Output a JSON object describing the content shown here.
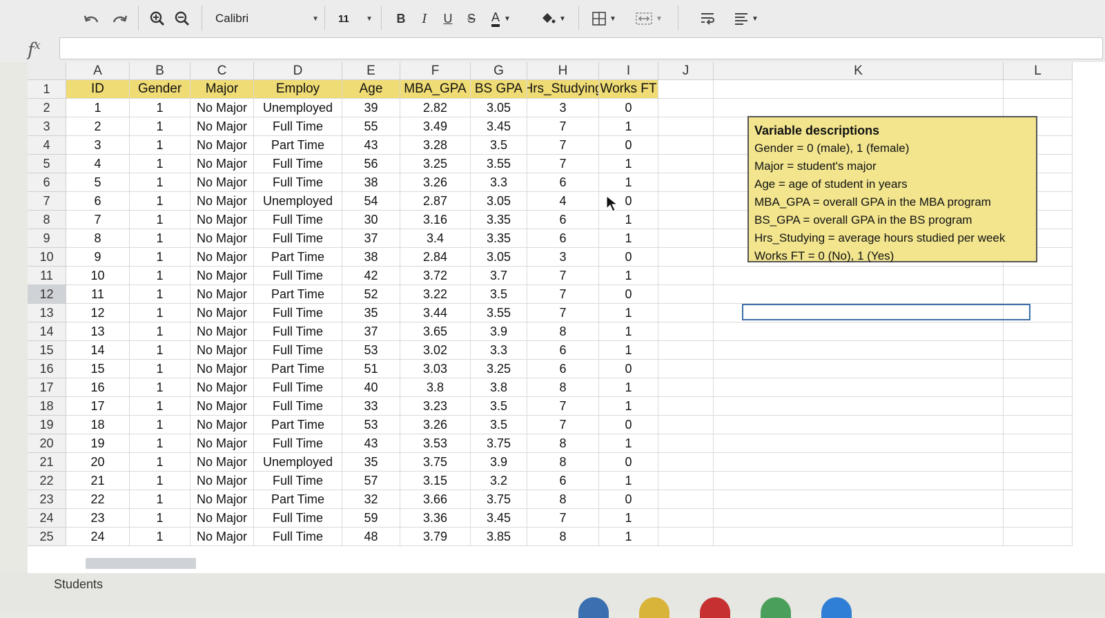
{
  "toolbar": {
    "font_name": "Calibri",
    "font_size": "11",
    "bold": "B",
    "italic": "I",
    "underline": "U",
    "strike": "S",
    "font_color": "A"
  },
  "formula_bar": {
    "label": "f",
    "sup": "x",
    "value": ""
  },
  "columns": [
    "A",
    "B",
    "C",
    "D",
    "E",
    "F",
    "G",
    "H",
    "I",
    "J",
    "K",
    "L"
  ],
  "headers": [
    "ID",
    "Gender",
    "Major",
    "Employ",
    "Age",
    "MBA_GPA",
    "BS GPA",
    "Hrs_Studying",
    "Works FT"
  ],
  "rows": [
    [
      "1",
      "1",
      "No Major",
      "Unemployed",
      "39",
      "2.82",
      "3.05",
      "3",
      "0"
    ],
    [
      "2",
      "1",
      "No Major",
      "Full Time",
      "55",
      "3.49",
      "3.45",
      "7",
      "1"
    ],
    [
      "3",
      "1",
      "No Major",
      "Part Time",
      "43",
      "3.28",
      "3.5",
      "7",
      "0"
    ],
    [
      "4",
      "1",
      "No Major",
      "Full Time",
      "56",
      "3.25",
      "3.55",
      "7",
      "1"
    ],
    [
      "5",
      "1",
      "No Major",
      "Full Time",
      "38",
      "3.26",
      "3.3",
      "6",
      "1"
    ],
    [
      "6",
      "1",
      "No Major",
      "Unemployed",
      "54",
      "2.87",
      "3.05",
      "4",
      "0"
    ],
    [
      "7",
      "1",
      "No Major",
      "Full Time",
      "30",
      "3.16",
      "3.35",
      "6",
      "1"
    ],
    [
      "8",
      "1",
      "No Major",
      "Full Time",
      "37",
      "3.4",
      "3.35",
      "6",
      "1"
    ],
    [
      "9",
      "1",
      "No Major",
      "Part Time",
      "38",
      "2.84",
      "3.05",
      "3",
      "0"
    ],
    [
      "10",
      "1",
      "No Major",
      "Full Time",
      "42",
      "3.72",
      "3.7",
      "7",
      "1"
    ],
    [
      "11",
      "1",
      "No Major",
      "Part Time",
      "52",
      "3.22",
      "3.5",
      "7",
      "0"
    ],
    [
      "12",
      "1",
      "No Major",
      "Full Time",
      "35",
      "3.44",
      "3.55",
      "7",
      "1"
    ],
    [
      "13",
      "1",
      "No Major",
      "Full Time",
      "37",
      "3.65",
      "3.9",
      "8",
      "1"
    ],
    [
      "14",
      "1",
      "No Major",
      "Full Time",
      "53",
      "3.02",
      "3.3",
      "6",
      "1"
    ],
    [
      "15",
      "1",
      "No Major",
      "Part Time",
      "51",
      "3.03",
      "3.25",
      "6",
      "0"
    ],
    [
      "16",
      "1",
      "No Major",
      "Full Time",
      "40",
      "3.8",
      "3.8",
      "8",
      "1"
    ],
    [
      "17",
      "1",
      "No Major",
      "Full Time",
      "33",
      "3.23",
      "3.5",
      "7",
      "1"
    ],
    [
      "18",
      "1",
      "No Major",
      "Part Time",
      "53",
      "3.26",
      "3.5",
      "7",
      "0"
    ],
    [
      "19",
      "1",
      "No Major",
      "Full Time",
      "43",
      "3.53",
      "3.75",
      "8",
      "1"
    ],
    [
      "20",
      "1",
      "No Major",
      "Unemployed",
      "35",
      "3.75",
      "3.9",
      "8",
      "0"
    ],
    [
      "21",
      "1",
      "No Major",
      "Full Time",
      "57",
      "3.15",
      "3.2",
      "6",
      "1"
    ],
    [
      "22",
      "1",
      "No Major",
      "Part Time",
      "32",
      "3.66",
      "3.75",
      "8",
      "0"
    ],
    [
      "23",
      "1",
      "No Major",
      "Full Time",
      "59",
      "3.36",
      "3.45",
      "7",
      "1"
    ],
    [
      "24",
      "1",
      "No Major",
      "Full Time",
      "48",
      "3.79",
      "3.85",
      "8",
      "1"
    ]
  ],
  "row_numbers": [
    "1",
    "2",
    "3",
    "4",
    "5",
    "6",
    "7",
    "8",
    "9",
    "10",
    "11",
    "12",
    "13",
    "14",
    "15",
    "16",
    "17",
    "18",
    "19",
    "20",
    "21",
    "22",
    "23",
    "24",
    "25"
  ],
  "selected_row": "12",
  "notes": {
    "title": "Variable descriptions",
    "lines": [
      "Gender = 0 (male), 1 (female)",
      "Major = student's major",
      "Age = age of student in years",
      "MBA_GPA = overall GPA in the MBA program",
      "BS_GPA = overall GPA in the BS program",
      "Hrs_Studying = average hours studied per week",
      "Works FT = 0 (No), 1 (Yes)"
    ]
  },
  "sheet_tab": "Students",
  "colors": {
    "header_fill": "#f0dc74",
    "note_fill": "#f2e58e",
    "active_border": "#3d6ea8"
  }
}
